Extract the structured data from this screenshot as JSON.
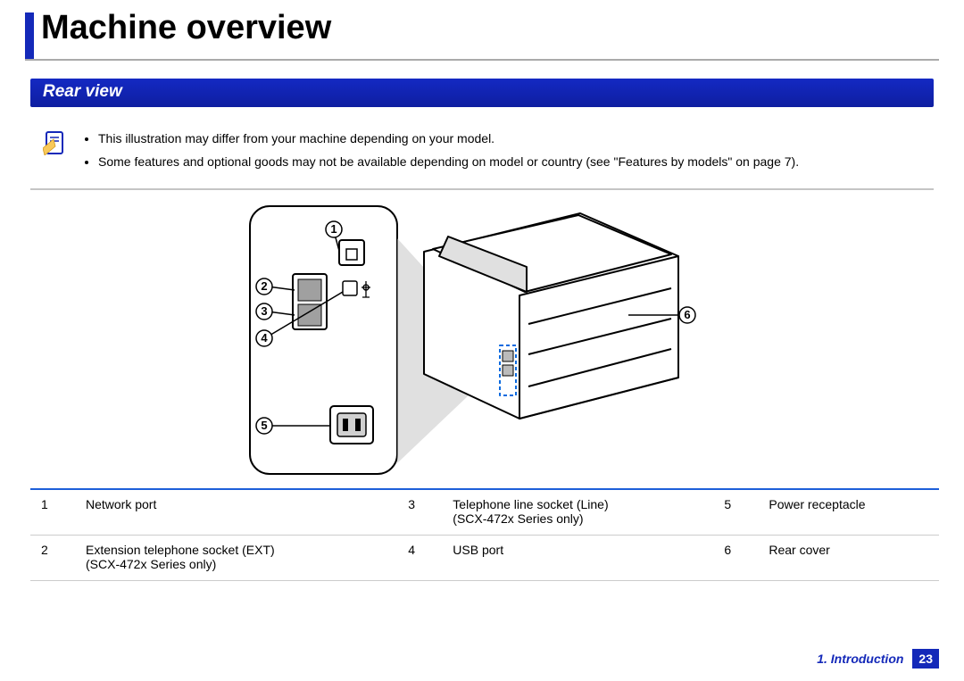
{
  "title": "Machine overview",
  "section": "Rear view",
  "notes": [
    "This illustration may differ from your machine depending on your model.",
    "Some features and optional goods may not be available depending on model or country (see \"Features by models\" on page 7)."
  ],
  "callouts": {
    "c1": "1",
    "c2": "2",
    "c3": "3",
    "c4": "4",
    "c5": "5",
    "c6": "6"
  },
  "legend": [
    {
      "num": "1",
      "label": "Network port",
      "sub": ""
    },
    {
      "num": "2",
      "label": "Extension telephone socket (EXT)",
      "sub": "(SCX-472x Series only)"
    },
    {
      "num": "3",
      "label": "Telephone line socket (Line)",
      "sub": "(SCX-472x Series only)"
    },
    {
      "num": "4",
      "label": "USB port",
      "sub": ""
    },
    {
      "num": "5",
      "label": "Power receptacle",
      "sub": ""
    },
    {
      "num": "6",
      "label": "Rear cover",
      "sub": ""
    }
  ],
  "footer": {
    "chapter": "1.  Introduction",
    "page": "23"
  }
}
